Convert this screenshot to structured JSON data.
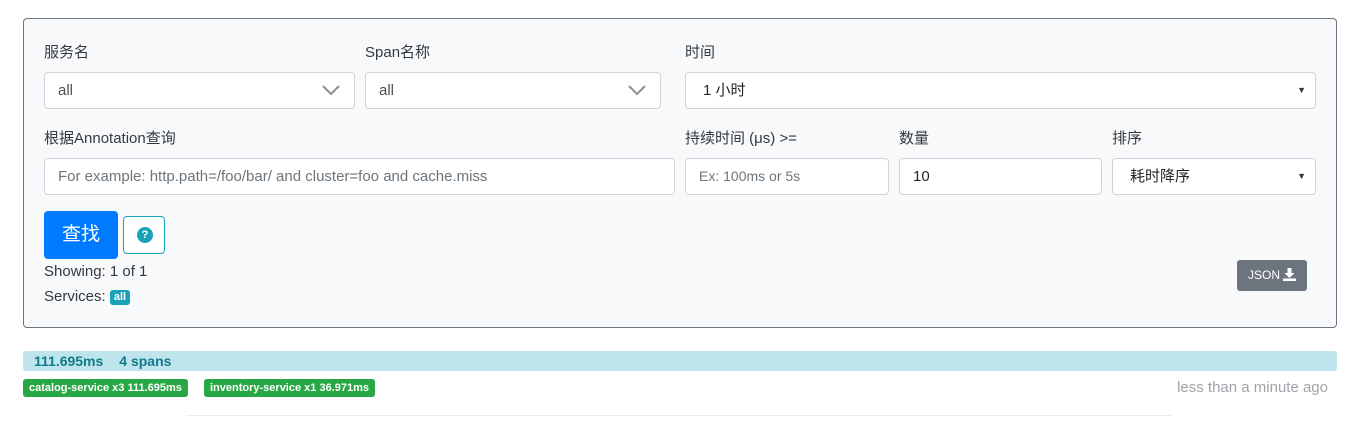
{
  "form": {
    "service_label": "服务名",
    "service_value": "all",
    "span_label": "Span名称",
    "span_value": "all",
    "time_label": "时间",
    "time_value": "1 小时",
    "annotation_label": "根据Annotation查询",
    "annotation_placeholder": "For example: http.path=/foo/bar/ and cluster=foo and cache.miss",
    "duration_label": "持续时间 (μs) >=",
    "duration_placeholder": "Ex: 100ms or 5s",
    "limit_label": "数量",
    "limit_value": "10",
    "sort_label": "排序",
    "sort_value": "耗时降序",
    "search_button": "查找",
    "help_icon_glyph": "?",
    "showing": "Showing: 1 of 1",
    "services_label": "Services:",
    "services_badge": "all",
    "json_button": "JSON",
    "icons": {
      "select_arrow": "chevron-down-icon",
      "help": "question-circle-icon",
      "download": "download-icon"
    }
  },
  "trace": {
    "duration": "111.695ms",
    "spans": "4 spans",
    "services": [
      {
        "label": "catalog-service x3 111.695ms"
      },
      {
        "label": "inventory-service x1 36.971ms"
      }
    ],
    "timestamp": "less than a minute ago"
  },
  "colors": {
    "primary": "#007bff",
    "info": "#17a2b8",
    "success": "#28a745",
    "secondary": "#6c757d",
    "trace_bar": "#bee5eb"
  }
}
